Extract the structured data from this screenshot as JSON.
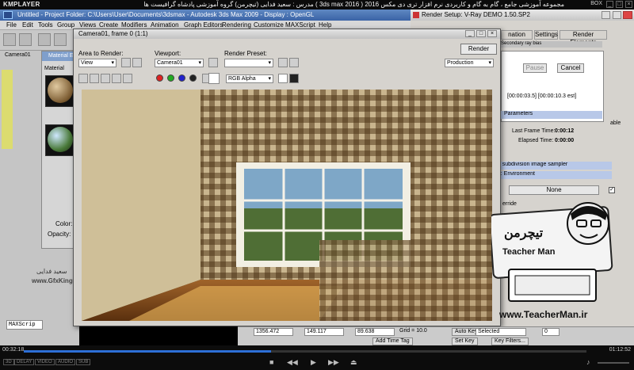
{
  "player": {
    "logo": "KMPLAYER",
    "title": "مجموعه آموزشی جامع ، گام به گام و کاربردی نرم افزار تری دی مکس 2016 ( 3ds max 2016 ) مدرس : سعید فدایی (تیچرمن) گروه آموزشی پادشاه گرافیست ها",
    "box_label": "BOX",
    "time_current": "00:32:18",
    "time_total": "01:12:52",
    "progress": 0.44,
    "chips": [
      "3D",
      "DELAY",
      "VIDEO",
      "AUDIO",
      "SUB"
    ]
  },
  "max": {
    "title": "Untitled     - Project Folder: C:\\Users\\User\\Documents\\3dsmax     - Autodesk 3ds Max  2009     - Display : OpenGL",
    "menu": [
      "File",
      "Edit",
      "Tools",
      "Group",
      "Views",
      "Create",
      "Modifiers",
      "Animation",
      "Graph Editors",
      "Rendering",
      "Customize",
      "MAXScript",
      "Help"
    ],
    "viewport_label": "Camera01",
    "material_editor_title": "Material E",
    "material_label": "Material",
    "color_label": "Color:",
    "opacity_label": "Opacity:",
    "maxscript_label": "MAXScrip",
    "status": {
      "x": "1356.472",
      "y": "149.117",
      "z": "89.638",
      "grid": "Grid = 10.0",
      "auto_key": "Auto Key",
      "selected": "Selected",
      "set_key": "Set Key",
      "key_filters": "Key Filters...",
      "add_time_tag": "Add Time Tag",
      "frame_value": "0"
    }
  },
  "frame_window": {
    "title": "Camera01, frame 0 (1:1)",
    "area_label": "Area to Render:",
    "area_value": "View",
    "viewport_label": "Viewport:",
    "viewport_value": "Camera01",
    "preset_label": "Render Preset:",
    "preset_value": "",
    "render_button": "Render",
    "production_value": "Production",
    "channel_value": "RGB Alpha"
  },
  "render_setup": {
    "title": "Render Setup: V-Ray DEMO 1.50.SP2",
    "tabs": [
      "nation",
      "Settings",
      "Render Elements"
    ],
    "pause": "Pause",
    "cancel": "Cancel",
    "time_readout": "[00:00:03.5] [00:00:10.3 est]",
    "parameters_label": "Parameters",
    "last_frame_label": "Last Frame Time:",
    "last_frame_value": "0:00:12",
    "elapsed_label": "Elapsed Time:",
    "elapsed_value": "0:00:00",
    "subdivision_label": "ne subdivision image sampler",
    "environment_label": "ap:  Environment",
    "none_label": "None",
    "override_label": "erride",
    "table_label": "able",
    "secondary_label": "Secondary ray bias"
  },
  "teacherman": {
    "brand_fa": "تیچرمن",
    "brand_en": "Teacher Man",
    "url": "www.TeacherMan.ir"
  },
  "watermark": {
    "site": "www.GfxKing.ir",
    "name": "سعید فدایی"
  }
}
